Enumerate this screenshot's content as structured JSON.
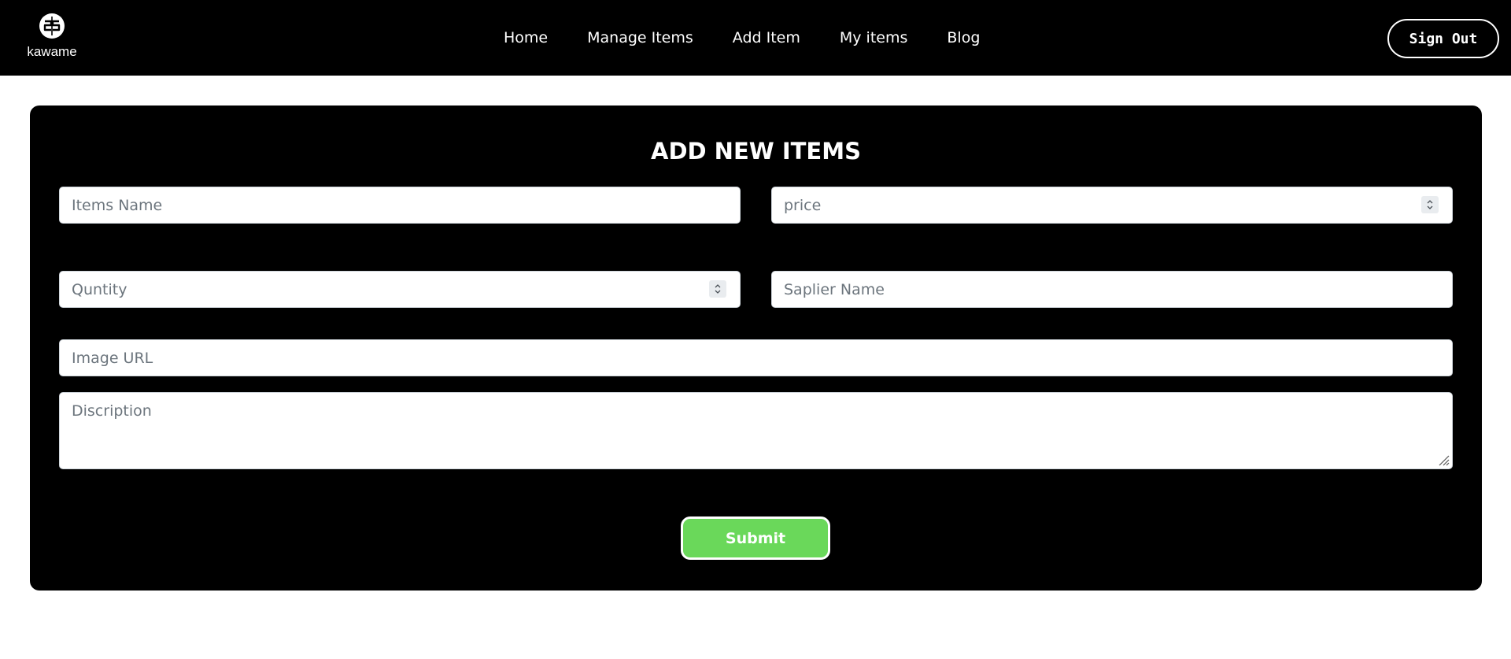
{
  "header": {
    "brand_name": "kawame",
    "nav": [
      {
        "label": "Home"
      },
      {
        "label": "Manage Items"
      },
      {
        "label": "Add Item"
      },
      {
        "label": "My items"
      },
      {
        "label": "Blog"
      }
    ],
    "signout_label": "Sign Out"
  },
  "form": {
    "title": "ADD NEW ITEMS",
    "items_name": {
      "placeholder": "Items Name",
      "value": ""
    },
    "price": {
      "placeholder": "price",
      "value": ""
    },
    "quantity": {
      "placeholder": "Quntity",
      "value": ""
    },
    "supplier_name": {
      "placeholder": "Saplier Name",
      "value": ""
    },
    "image_url": {
      "placeholder": "Image URL",
      "value": ""
    },
    "description": {
      "placeholder": "Discription",
      "value": ""
    },
    "submit_label": "Submit"
  },
  "icons": {
    "brand_logo": "kawame-logo-icon",
    "spinner": "number-spinner-icon",
    "resize": "resize-grip-icon"
  },
  "colors": {
    "header_bg": "#000000",
    "card_bg": "#000000",
    "submit_bg": "#6ad85a",
    "page_bg": "#ffffff"
  }
}
